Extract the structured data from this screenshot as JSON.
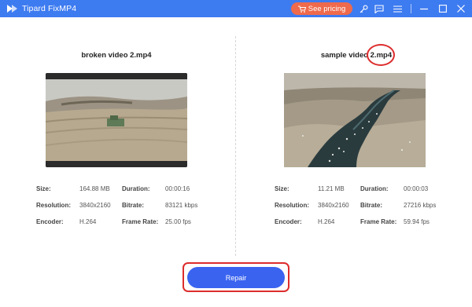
{
  "app": {
    "title": "Tipard FixMP4"
  },
  "header": {
    "pricing_label": "See pricing",
    "colors": {
      "bar": "#3d7bf0",
      "pricing": "#ef6a4c"
    },
    "icons": [
      "cart-icon",
      "key-icon",
      "feedback-icon",
      "menu-icon",
      "minimize-icon",
      "maximize-icon",
      "close-icon"
    ]
  },
  "labels": {
    "size": "Size:",
    "duration": "Duration:",
    "resolution": "Resolution:",
    "bitrate": "Bitrate:",
    "encoder": "Encoder:",
    "frame_rate": "Frame Rate:"
  },
  "broken": {
    "filename": "broken video 2.mp4",
    "size": "164.88 MB",
    "duration": "00:00:16",
    "resolution": "3840x2160",
    "bitrate": "83121 kbps",
    "encoder": "H.264",
    "frame_rate": "25.00 fps"
  },
  "sample": {
    "filename": "sample video 2.mp4",
    "size": "11.21 MB",
    "duration": "00:00:03",
    "resolution": "3840x2160",
    "bitrate": "27216 kbps",
    "encoder": "H.264",
    "frame_rate": "59.94 fps"
  },
  "actions": {
    "repair_label": "Repair",
    "accent": "#3a63f0",
    "highlight": "#dd2c2c"
  }
}
